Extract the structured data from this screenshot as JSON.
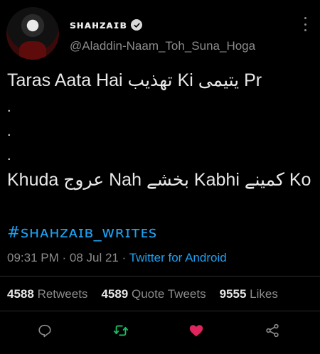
{
  "user": {
    "display_name": "ꜱʜᴀʜᴢᴀɪʙ",
    "handle": "@Aladdin-Naam_Toh_Suna_Hoga",
    "verified": true
  },
  "tweet": {
    "line1": "Taras Aata Hai تھذیب Ki یتیمی Pr",
    "dots": [
      ".",
      ".",
      "."
    ],
    "line2": "Khuda عروج Nah بخشے Kabhi کمینے Ko",
    "hashtag": "#ꜱʜᴀʜᴢᴀɪʙ_ᴡʀɪᴛᴇꜱ"
  },
  "meta": {
    "time": "09:31 PM",
    "separator": " · ",
    "date": "08 Jul 21",
    "source": "Twitter for Android"
  },
  "stats": {
    "retweets_count": "4588",
    "retweets_label": "Retweets",
    "quote_count": "4589",
    "quote_label": "Quote Tweets",
    "likes_count": "9555",
    "likes_label": "Likes"
  },
  "colors": {
    "accent": "#1da1f2",
    "retweet": "#17bf63",
    "like": "#e0245e",
    "muted": "#8b8b8b"
  },
  "icons": [
    "verified-badge-icon",
    "more-options-icon",
    "reply-icon",
    "retweet-icon",
    "like-icon",
    "share-icon"
  ]
}
